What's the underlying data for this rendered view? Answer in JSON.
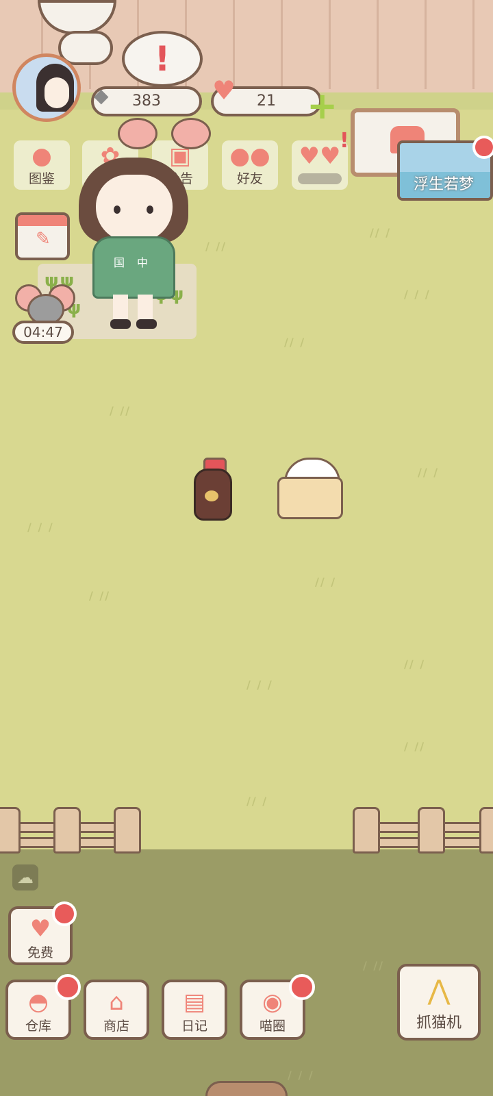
{
  "resources": {
    "fish_count": "383",
    "heart_count": "21"
  },
  "alert_symbol": "!",
  "top_menu": [
    {
      "label": "图鉴",
      "icon": "cat-head-icon"
    },
    {
      "label": "设置",
      "icon": "gear-icon"
    },
    {
      "label": "公告",
      "icon": "gift-icon"
    },
    {
      "label": "好友",
      "icon": "friends-icon"
    },
    {
      "label": "",
      "icon": "hearts-icon"
    }
  ],
  "event_banner": {
    "label": "浮生若梦"
  },
  "timer": "04:47",
  "bottom_menu": {
    "free": "免费",
    "warehouse": "仓库",
    "shop": "商店",
    "diary": "日记",
    "circle": "喵圈",
    "claw_machine": "抓猫机"
  },
  "character": {
    "shirt_text_left": "国",
    "shirt_text_right": "中"
  },
  "colors": {
    "accent": "#ef8478",
    "outline": "#7b5f4e",
    "grass": "#d8d890",
    "notify": "#e85b5a"
  }
}
